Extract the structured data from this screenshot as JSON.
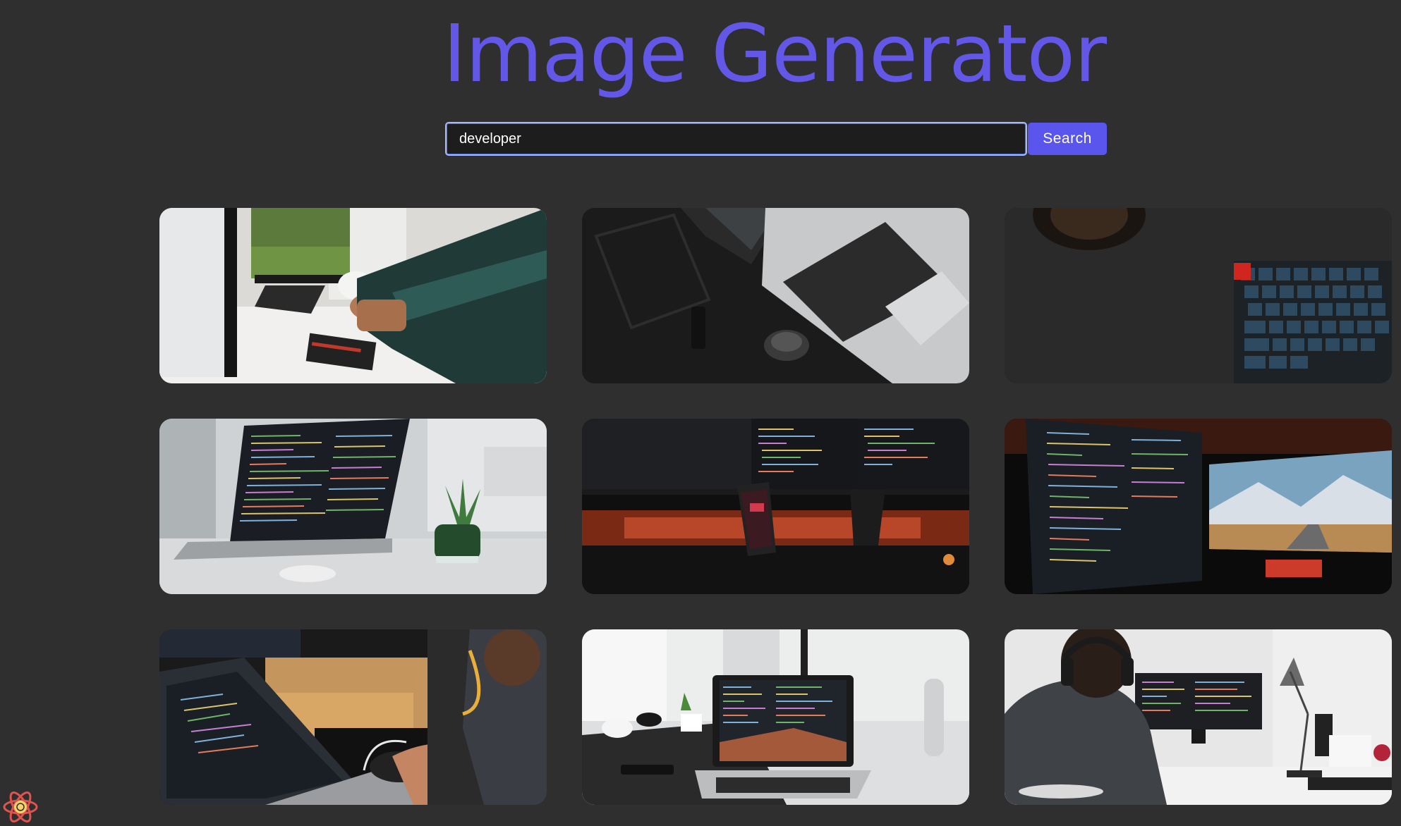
{
  "app": {
    "title": "Image Generator"
  },
  "search": {
    "value": "developer",
    "button_label": "Search"
  },
  "results": [
    {
      "name": "result-image-1"
    },
    {
      "name": "result-image-2"
    },
    {
      "name": "result-image-3"
    },
    {
      "name": "result-image-4"
    },
    {
      "name": "result-image-5"
    },
    {
      "name": "result-image-6"
    },
    {
      "name": "result-image-7"
    },
    {
      "name": "result-image-8"
    },
    {
      "name": "result-image-9"
    }
  ],
  "colors": {
    "background": "#2f2f2f",
    "accent": "#6357e8",
    "button": "#5a55ec",
    "input_border": "#a7b8ff"
  },
  "icons": {
    "corner_logo": "react-logo-icon"
  }
}
